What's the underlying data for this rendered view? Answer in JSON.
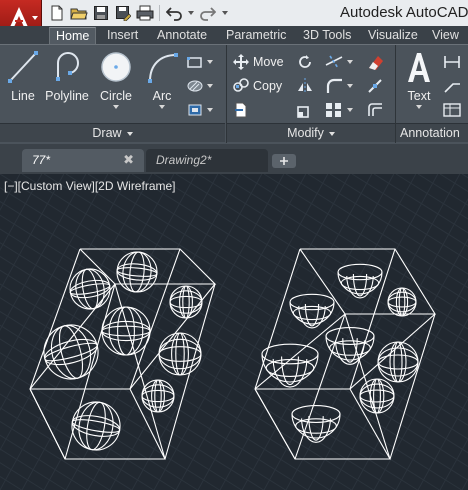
{
  "app": {
    "title": "Autodesk AutoCAD",
    "logo_letter": "A"
  },
  "quick_access": {
    "items": [
      "new-icon",
      "open-icon",
      "save-icon",
      "save-as-icon",
      "plot-icon",
      "undo-icon",
      "redo-icon"
    ]
  },
  "ribbon": {
    "tabs": [
      "Home",
      "Insert",
      "Annotate",
      "Parametric",
      "3D Tools",
      "Visualize",
      "View"
    ],
    "active_tab": "Home",
    "draw": {
      "title": "Draw",
      "tools": {
        "line": "Line",
        "polyline": "Polyline",
        "circle": "Circle",
        "arc": "Arc"
      }
    },
    "modify": {
      "title": "Modify",
      "move": "Move",
      "copy": "Copy"
    },
    "annotation": {
      "title": "Annotation",
      "text": "Text"
    }
  },
  "documents": {
    "tabs": [
      {
        "label": "77*",
        "active": true
      },
      {
        "label": "Drawing2*",
        "active": false
      }
    ],
    "close_glyph": "✖"
  },
  "viewport": {
    "label": "[−][Custom View][2D Wireframe]",
    "background": "#212830",
    "wire_color": "#ffffff"
  },
  "colors": {
    "accent_red": "#c52a22",
    "ribbon_bg": "#4b535b",
    "titlebar_bg": "#e9ecef"
  }
}
